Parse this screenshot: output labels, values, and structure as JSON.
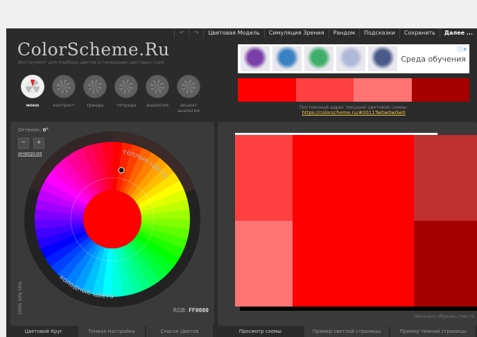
{
  "topnav": {
    "undo": "↶",
    "redo": "↷",
    "items": [
      "Цветовая Модель",
      "Симуляция Зрения",
      "Рандом",
      "Подсказки",
      "Сохранить",
      "Далее ..."
    ]
  },
  "logo": "ColorScheme.Ru",
  "tagline": "Инструмент для подбора цветов и генерации цветовых схем",
  "modes": [
    {
      "label": "моно",
      "active": true
    },
    {
      "label": "контраст",
      "active": false
    },
    {
      "label": "триада",
      "active": false
    },
    {
      "label": "тетрада",
      "active": false
    },
    {
      "label": "аналогия",
      "active": false
    },
    {
      "label": "акцент аналогия",
      "active": false
    }
  ],
  "ad": {
    "text": "Среда обучения",
    "info_icon": "info-icon",
    "thumb_colors": [
      "#7a3fa8",
      "#3b82c4",
      "#3fae6a",
      "#b0b8d8",
      "#4a5a8a"
    ]
  },
  "swatches": [
    "#FF0000",
    "#FF4040",
    "#FF7373",
    "#A60000"
  ],
  "permalink": {
    "label": "Постоянный адрес текущей цветовой схемы:",
    "url": "https://colorscheme.ru/#0011Tw0w0w0w0"
  },
  "wheel_panel": {
    "hue_label": "Оттенок:",
    "hue_value": "0°",
    "minus": "−",
    "plus": "+",
    "invert": "инверсия",
    "warm_label": "тёплые цвета",
    "cold_label": "холодные цвета",
    "rgb_label": "RGB:",
    "rgb_value": "FF0000",
    "sat_label": "100% 50% 50%"
  },
  "preview": {
    "colors": {
      "main": "#FF0000",
      "light1": "#FF4040",
      "light2": "#FF7373",
      "dark1": "#BF3030",
      "dark2": "#A60000"
    },
    "show_text": "Показать образец текста"
  },
  "tabs_left": [
    "Цветовой Круг",
    "Тонкая Настройка",
    "Список Цветов"
  ],
  "tabs_right": [
    "Просмотр схемы",
    "Пример светлой страницы",
    "Пример темной страницы"
  ]
}
